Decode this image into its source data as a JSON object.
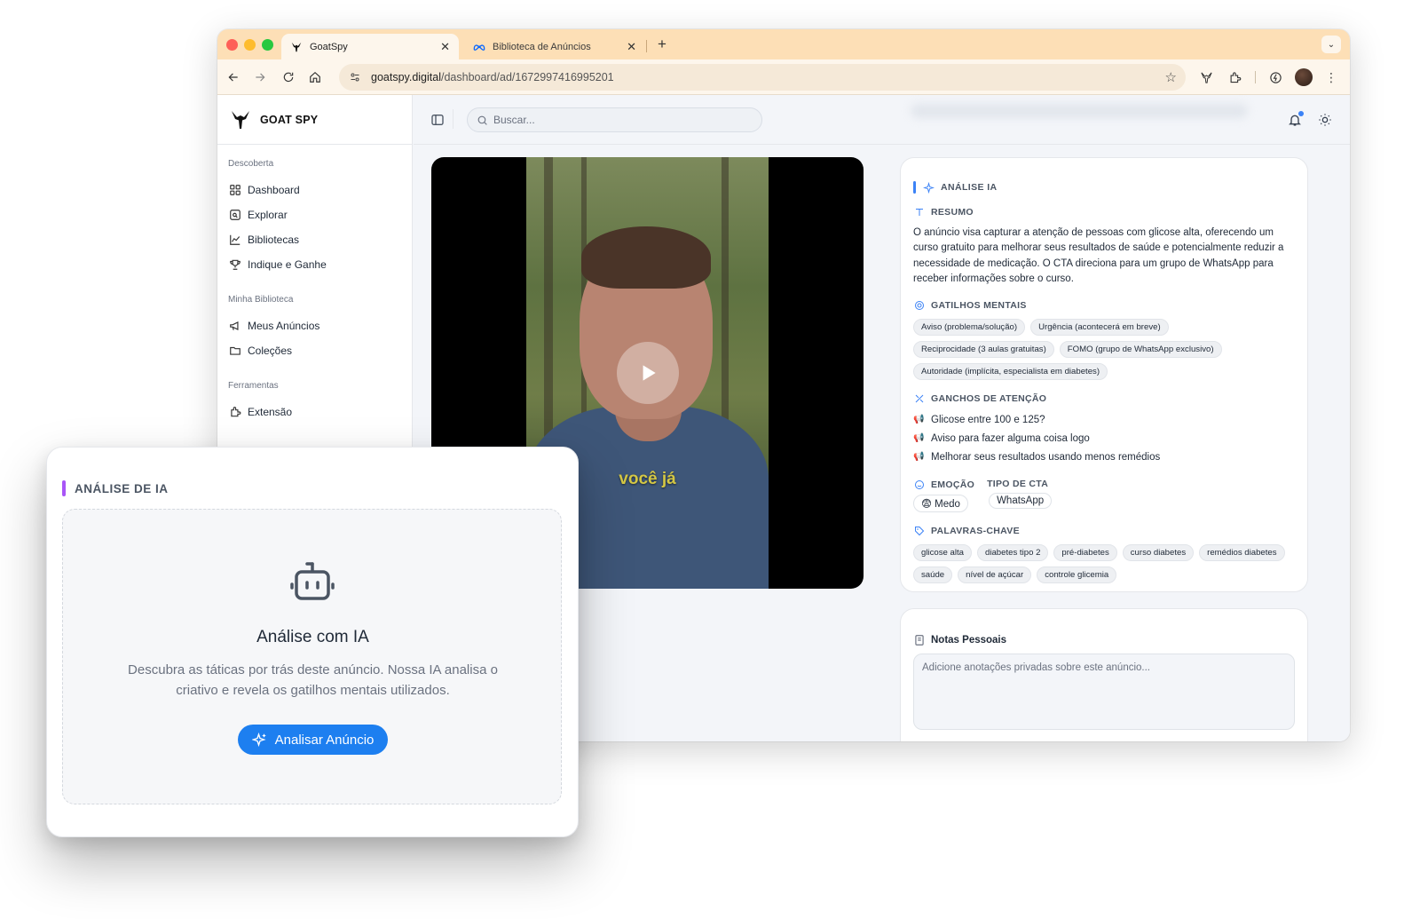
{
  "browser": {
    "tabs": [
      {
        "title": "GoatSpy",
        "active": true,
        "icon": "goat-logo-icon"
      },
      {
        "title": "Biblioteca de Anúncios",
        "active": false,
        "icon": "meta-logo-icon"
      }
    ],
    "url_domain": "goatspy.digital",
    "url_path": "/dashboard/ad/1672997416995201"
  },
  "sidebar": {
    "brand": "GOAT SPY",
    "sections": [
      {
        "heading": "Descoberta",
        "items": [
          {
            "label": "Dashboard",
            "icon": "grid-icon"
          },
          {
            "label": "Explorar",
            "icon": "explore-icon"
          },
          {
            "label": "Bibliotecas",
            "icon": "chart-line-icon"
          },
          {
            "label": "Indique e Ganhe",
            "icon": "trophy-icon"
          }
        ]
      },
      {
        "heading": "Minha Biblioteca",
        "items": [
          {
            "label": "Meus Anúncios",
            "icon": "megaphone-icon"
          },
          {
            "label": "Coleções",
            "icon": "folder-icon"
          }
        ]
      },
      {
        "heading": "Ferramentas",
        "items": [
          {
            "label": "Extensão",
            "icon": "puzzle-icon"
          }
        ]
      }
    ]
  },
  "topbar": {
    "search_placeholder": "Buscar..."
  },
  "video": {
    "subtitle": "você já"
  },
  "analysis": {
    "header": "ANÁLISE IA",
    "summary_title": "RESUMO",
    "summary": "O anúncio visa capturar a atenção de pessoas com glicose alta, oferecendo um curso gratuito para melhorar seus resultados de saúde e potencialmente reduzir a necessidade de medicação. O CTA direciona para um grupo de WhatsApp para receber informações sobre o curso.",
    "triggers_title": "GATILHOS MENTAIS",
    "triggers": [
      "Aviso (problema/solução)",
      "Urgência (acontecerá em breve)",
      "Reciprocidade (3 aulas gratuitas)",
      "FOMO (grupo de WhatsApp exclusivo)",
      "Autoridade (implícita, especialista em diabetes)"
    ],
    "hooks_title": "GANCHOS DE ATENÇÃO",
    "hooks": [
      "Glicose entre 100 e 125?",
      "Aviso para fazer alguma coisa logo",
      "Melhorar seus resultados usando menos remédios"
    ],
    "emotion_title": "EMOÇÃO",
    "emotion": "😨 Medo",
    "cta_title": "TIPO DE CTA",
    "cta": "WhatsApp",
    "keywords_title": "PALAVRAS-CHAVE",
    "keywords": [
      "glicose alta",
      "diabetes tipo 2",
      "pré-diabetes",
      "curso diabetes",
      "remédios diabetes",
      "saúde",
      "nível de açúcar",
      "controle glicemia"
    ]
  },
  "notes": {
    "title": "Notas Pessoais",
    "placeholder": "Adicione anotações privadas sobre este anúncio..."
  },
  "floating": {
    "header": "ANÁLISE DE IA",
    "title": "Análise com IA",
    "description": "Descubra as táticas por trás deste anúncio. Nossa IA analisa o criativo e revela os gatilhos mentais utilizados.",
    "button": "Analisar Anúncio"
  },
  "colors": {
    "tabbar": "#fddfb6",
    "accent_blue": "#1d7ff0",
    "accent_purple": "#a855f7"
  }
}
